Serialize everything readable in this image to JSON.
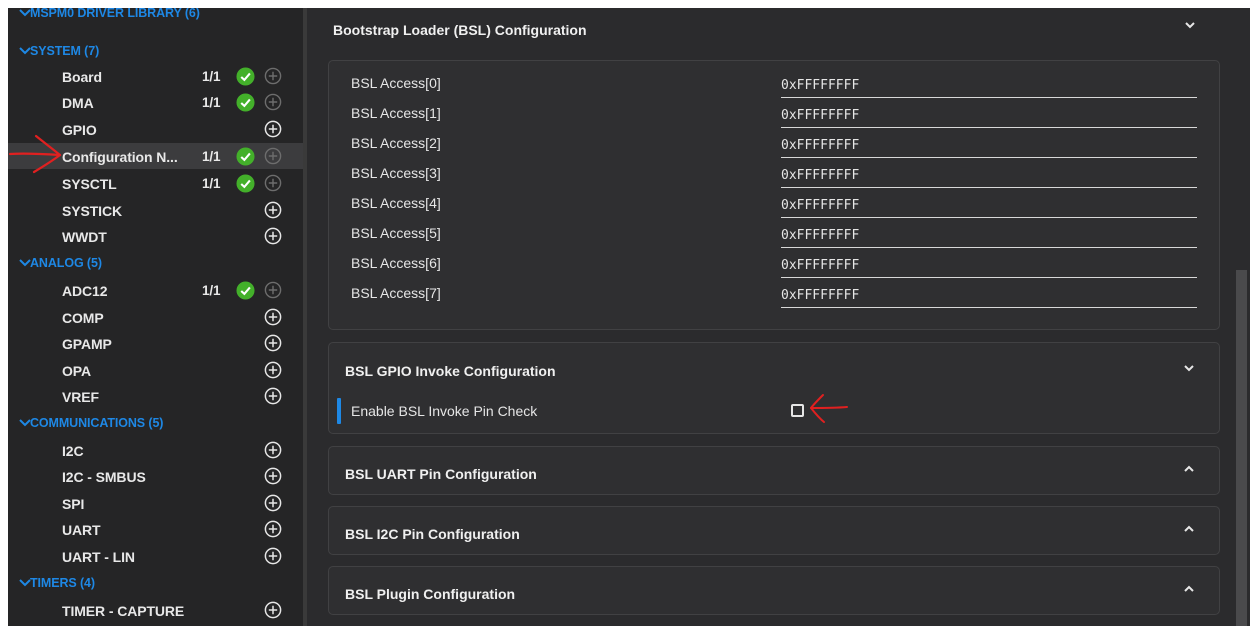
{
  "sidebar": {
    "header": "MSPM0 DRIVER LIBRARY (6)",
    "categories": [
      {
        "label": "SYSTEM (7)",
        "modules": [
          {
            "label": "Board",
            "count": "1/1",
            "status": "added"
          },
          {
            "label": "DMA",
            "count": "1/1",
            "status": "added"
          },
          {
            "label": "GPIO",
            "count": "",
            "status": "none"
          },
          {
            "label": "Configuration N...",
            "count": "1/1",
            "status": "added"
          },
          {
            "label": "SYSCTL",
            "count": "1/1",
            "status": "added"
          },
          {
            "label": "SYSTICK",
            "count": "",
            "status": "none"
          },
          {
            "label": "WWDT",
            "count": "",
            "status": "none"
          }
        ]
      },
      {
        "label": "ANALOG (5)",
        "modules": [
          {
            "label": "ADC12",
            "count": "1/1",
            "status": "added"
          },
          {
            "label": "COMP",
            "count": "",
            "status": "none"
          },
          {
            "label": "GPAMP",
            "count": "",
            "status": "none"
          },
          {
            "label": "OPA",
            "count": "",
            "status": "none"
          },
          {
            "label": "VREF",
            "count": "",
            "status": "none"
          }
        ]
      },
      {
        "label": "COMMUNICATIONS (5)",
        "modules": [
          {
            "label": "I2C",
            "count": "",
            "status": "none"
          },
          {
            "label": "I2C - SMBUS",
            "count": "",
            "status": "none"
          },
          {
            "label": "SPI",
            "count": "",
            "status": "none"
          },
          {
            "label": "UART",
            "count": "",
            "status": "none"
          },
          {
            "label": "UART - LIN",
            "count": "",
            "status": "none"
          }
        ]
      },
      {
        "label": "TIMERS (4)",
        "modules": [
          {
            "label": "TIMER - CAPTURE",
            "count": "",
            "status": "none"
          }
        ]
      }
    ]
  },
  "main": {
    "bsl_config_title": "Bootstrap Loader (BSL) Configuration",
    "bsl_access": [
      {
        "label": "BSL Access[0]",
        "value": "0xFFFFFFFF"
      },
      {
        "label": "BSL Access[1]",
        "value": "0xFFFFFFFF"
      },
      {
        "label": "BSL Access[2]",
        "value": "0xFFFFFFFF"
      },
      {
        "label": "BSL Access[3]",
        "value": "0xFFFFFFFF"
      },
      {
        "label": "BSL Access[4]",
        "value": "0xFFFFFFFF"
      },
      {
        "label": "BSL Access[5]",
        "value": "0xFFFFFFFF"
      },
      {
        "label": "BSL Access[6]",
        "value": "0xFFFFFFFF"
      },
      {
        "label": "BSL Access[7]",
        "value": "0xFFFFFFFF"
      }
    ],
    "gpio_invoke_title": "BSL GPIO Invoke Configuration",
    "invoke_pin_check_label": "Enable BSL Invoke Pin Check",
    "invoke_pin_check_checked": false,
    "uart_pin_title": "BSL UART Pin Configuration",
    "i2c_pin_title": "BSL I2C Pin Configuration",
    "plugin_title": "BSL Plugin Configuration"
  },
  "colors": {
    "sidebar_bg": "#252526",
    "main_bg": "#2b2b2d",
    "accent_blue": "#1e88e5",
    "check_green": "#43b02a",
    "annotation_red": "#e02020"
  },
  "icons": {
    "expand": "chevron-down-icon",
    "collapse": "chevron-up-icon",
    "added": "check-circle-icon",
    "add": "plus-circle-icon"
  }
}
